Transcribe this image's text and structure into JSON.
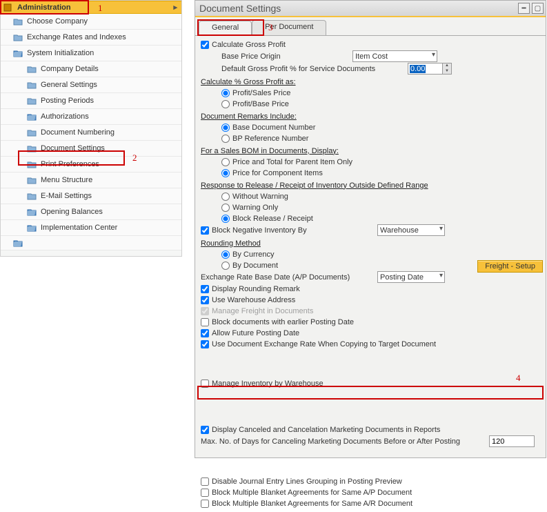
{
  "sidebar": {
    "header": "Administration",
    "items": [
      {
        "label": "Choose Company",
        "icon": "folder",
        "level": 1
      },
      {
        "label": "Exchange Rates and Indexes",
        "icon": "folder",
        "level": 1
      },
      {
        "label": "System Initialization",
        "icon": "open-folder",
        "level": 1
      },
      {
        "label": "Company Details",
        "icon": "folder",
        "level": 2
      },
      {
        "label": "General Settings",
        "icon": "folder",
        "level": 2
      },
      {
        "label": "Posting Periods",
        "icon": "folder",
        "level": 2
      },
      {
        "label": "Authorizations",
        "icon": "open-folder",
        "level": 2
      },
      {
        "label": "Document Numbering",
        "icon": "folder",
        "level": 2
      },
      {
        "label": "Document Settings",
        "icon": "folder",
        "level": 2
      },
      {
        "label": "Print Preferences",
        "icon": "folder",
        "level": 2
      },
      {
        "label": "Menu Structure",
        "icon": "folder",
        "level": 2
      },
      {
        "label": "E-Mail Settings",
        "icon": "folder",
        "level": 2
      },
      {
        "label": "Opening Balances",
        "icon": "open-folder",
        "level": 2
      },
      {
        "label": "Implementation Center",
        "icon": "open-folder",
        "level": 2
      }
    ]
  },
  "annotations": {
    "a1": "1",
    "a2": "2",
    "a3": "3",
    "a4": "4"
  },
  "window": {
    "title": "Document Settings",
    "tabs": {
      "general": "General",
      "per_document": "Per Document"
    }
  },
  "settings": {
    "calc_gross_profit": "Calculate Gross Profit",
    "base_price_origin_label": "Base Price Origin",
    "base_price_origin_value": "Item Cost",
    "default_gp_label": "Default Gross Profit % for Service Documents",
    "default_gp_value": "0.00",
    "calc_pct_head": "Calculate % Gross Profit as:",
    "profit_sales": "Profit/Sales Price",
    "profit_base": "Profit/Base Price",
    "remarks_head": "Document Remarks Include:",
    "base_doc_num": "Base Document Number",
    "bp_ref_num": "BP Reference Number",
    "sales_bom_head": "For a Sales BOM in Documents, Display:",
    "price_total_parent": "Price and Total for Parent Item Only",
    "price_component": "Price for Component Items",
    "response_head": "Response to Release / Receipt of Inventory Outside Defined Range",
    "without_warning": "Without Warning",
    "warning_only": "Warning Only",
    "block_release": "Block Release / Receipt",
    "block_neg_label": "Block Negative Inventory By",
    "block_neg_value": "Warehouse",
    "rounding_head": "Rounding Method",
    "by_currency": "By Currency",
    "by_document": "By Document",
    "ex_rate_label": "Exchange Rate Base Date (A/P Documents)",
    "ex_rate_value": "Posting Date",
    "display_rounding": "Display Rounding Remark",
    "use_warehouse": "Use Warehouse Address",
    "manage_freight": "Manage Freight in Documents",
    "freight_btn": "Freight - Setup",
    "block_earlier": "Block documents with earlier Posting Date",
    "allow_future": "Allow Future Posting Date",
    "use_doc_exrate": "Use Document Exchange Rate When Copying to Target Document",
    "manage_inv_wh": "Manage Inventory by Warehouse",
    "display_canceled": "Display Canceled and Cancelation Marketing Documents in Reports",
    "max_days_label": "Max. No. of Days for Canceling Marketing Documents Before or After Posting",
    "max_days_value": "120",
    "disable_journal": "Disable Journal Entry Lines Grouping in Posting Preview",
    "block_multi_ap": "Block Multiple Blanket Agreements for Same A/P Document",
    "block_multi_ar": "Block Multiple Blanket Agreements for Same A/R Document"
  }
}
